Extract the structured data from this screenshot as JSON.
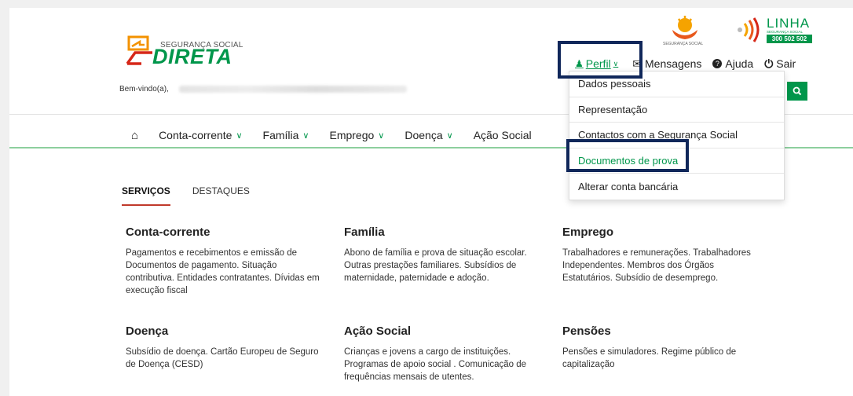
{
  "logo": {
    "small": "SEGURANÇA SOCIAL",
    "big": "DIRETA"
  },
  "ss_logo_caption": "SEGURANÇA SOCIAL",
  "linha": {
    "title": "LINHA",
    "sub": "SEGURANÇA SOCIAL",
    "number": "300 502 502"
  },
  "topnav": {
    "perfil": "Perfil",
    "mensagens": "Mensagens",
    "ajuda": "Ajuda",
    "sair": "Sair"
  },
  "welcome": "Bem-vindo(a),",
  "mainnav": [
    "Conta-corrente",
    "Família",
    "Emprego",
    "Doença",
    "Ação Social"
  ],
  "dropdown": [
    "Dados pessoais",
    "Representação",
    "Contactos com a Segurança Social",
    "Documentos de prova",
    "Alterar conta bancária"
  ],
  "tabs": [
    "SERVIÇOS",
    "DESTAQUES"
  ],
  "sections": [
    {
      "title": "Conta-corrente",
      "text": "Pagamentos e recebimentos e emissão de Documentos de pagamento. Situação contributiva. Entidades contratantes. Dívidas em execução fiscal"
    },
    {
      "title": "Família",
      "text": "Abono de família e prova de situação escolar. Outras prestações familiares. Subsídios de maternidade, paternidade e adoção."
    },
    {
      "title": "Emprego",
      "text": "Trabalhadores e remunerações. Trabalhadores Independentes. Membros dos Órgãos Estatutários. Subsídio de desemprego."
    },
    {
      "title": "Doença",
      "text": "Subsídio de doença. Cartão Europeu de Seguro de Doença (CESD)"
    },
    {
      "title": "Ação Social",
      "text": "Crianças e jovens a cargo de instituições. Programas de apoio social . Comunicação de frequências mensais de utentes."
    },
    {
      "title": "Pensões",
      "text": "Pensões e simuladores. Regime público de capitalização"
    }
  ],
  "colors": {
    "brand_green": "#00964b",
    "accent_red": "#c0392b",
    "highlight_navy": "#10275a"
  }
}
